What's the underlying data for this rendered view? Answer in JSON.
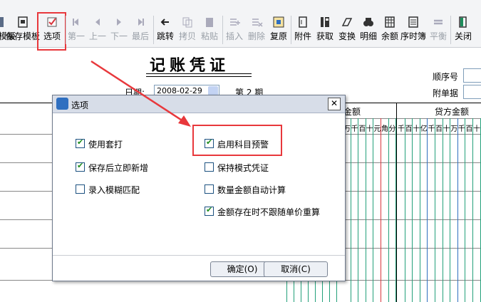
{
  "toolbar": {
    "items": [
      {
        "label": "存模板",
        "icon": "save-icon",
        "disabled": false
      },
      {
        "label": "保存模板",
        "icon": "save-template-icon",
        "disabled": false
      },
      {
        "label": "选项",
        "icon": "options-icon",
        "disabled": false
      },
      {
        "label": "第一",
        "icon": "first-icon",
        "disabled": true
      },
      {
        "label": "上一",
        "icon": "prev-icon",
        "disabled": true
      },
      {
        "label": "下一",
        "icon": "next-icon",
        "disabled": true
      },
      {
        "label": "最后",
        "icon": "last-icon",
        "disabled": true
      },
      {
        "label": "跳转",
        "icon": "jump-icon",
        "disabled": false
      },
      {
        "label": "拷贝",
        "icon": "copy-icon",
        "disabled": true
      },
      {
        "label": "粘贴",
        "icon": "paste-icon",
        "disabled": true
      },
      {
        "label": "插入",
        "icon": "insert-icon",
        "disabled": true
      },
      {
        "label": "删除",
        "icon": "delete-icon",
        "disabled": true
      },
      {
        "label": "复原",
        "icon": "restore-icon",
        "disabled": false
      },
      {
        "label": "附件",
        "icon": "attach-icon",
        "disabled": false
      },
      {
        "label": "获取",
        "icon": "fetch-icon",
        "disabled": false
      },
      {
        "label": "变换",
        "icon": "transform-icon",
        "disabled": false
      },
      {
        "label": "明细",
        "icon": "detail-icon",
        "disabled": false
      },
      {
        "label": "余额",
        "icon": "balance-icon",
        "disabled": false
      },
      {
        "label": "序时簿",
        "icon": "journal-icon",
        "disabled": false
      },
      {
        "label": "平衡",
        "icon": "balance-check-icon",
        "disabled": true
      },
      {
        "label": "关闭",
        "icon": "close-door-icon",
        "disabled": false
      }
    ]
  },
  "voucher": {
    "title": "记账凭证",
    "date_label": "日期:",
    "date_value": "2008-02-29",
    "period_label": "第 2 期",
    "seq_label": "顺序号",
    "attach_label": "附单据",
    "debit_header": "金额",
    "credit_header": "贷方金额",
    "digit_header_left": [
      "万",
      "千",
      "百",
      "十",
      "元",
      "角",
      "分"
    ],
    "digit_header_right": [
      "千",
      "百",
      "十",
      "亿",
      "千",
      "百",
      "十",
      "万",
      "千",
      "百",
      "十"
    ]
  },
  "dialog": {
    "title": "选项",
    "close_glyph": "✕",
    "options": [
      {
        "label": "使用套打",
        "checked": true
      },
      {
        "label": "保存后立即新增",
        "checked": true
      },
      {
        "label": "录入模糊匹配",
        "checked": false
      },
      {
        "label": "启用科目预警",
        "checked": true
      },
      {
        "label": "保持模式凭证",
        "checked": false
      },
      {
        "label": "数量金额自动计算",
        "checked": false
      },
      {
        "label": "金额存在时不跟随单价重算",
        "checked": true
      }
    ],
    "ok_label": "确定(O)",
    "cancel_label": "取消(C)"
  },
  "colors": {
    "highlight": "#e8383c",
    "accent": "#2f6fc0",
    "grid_green": "#23a07a",
    "grid_red": "#d9363e"
  }
}
